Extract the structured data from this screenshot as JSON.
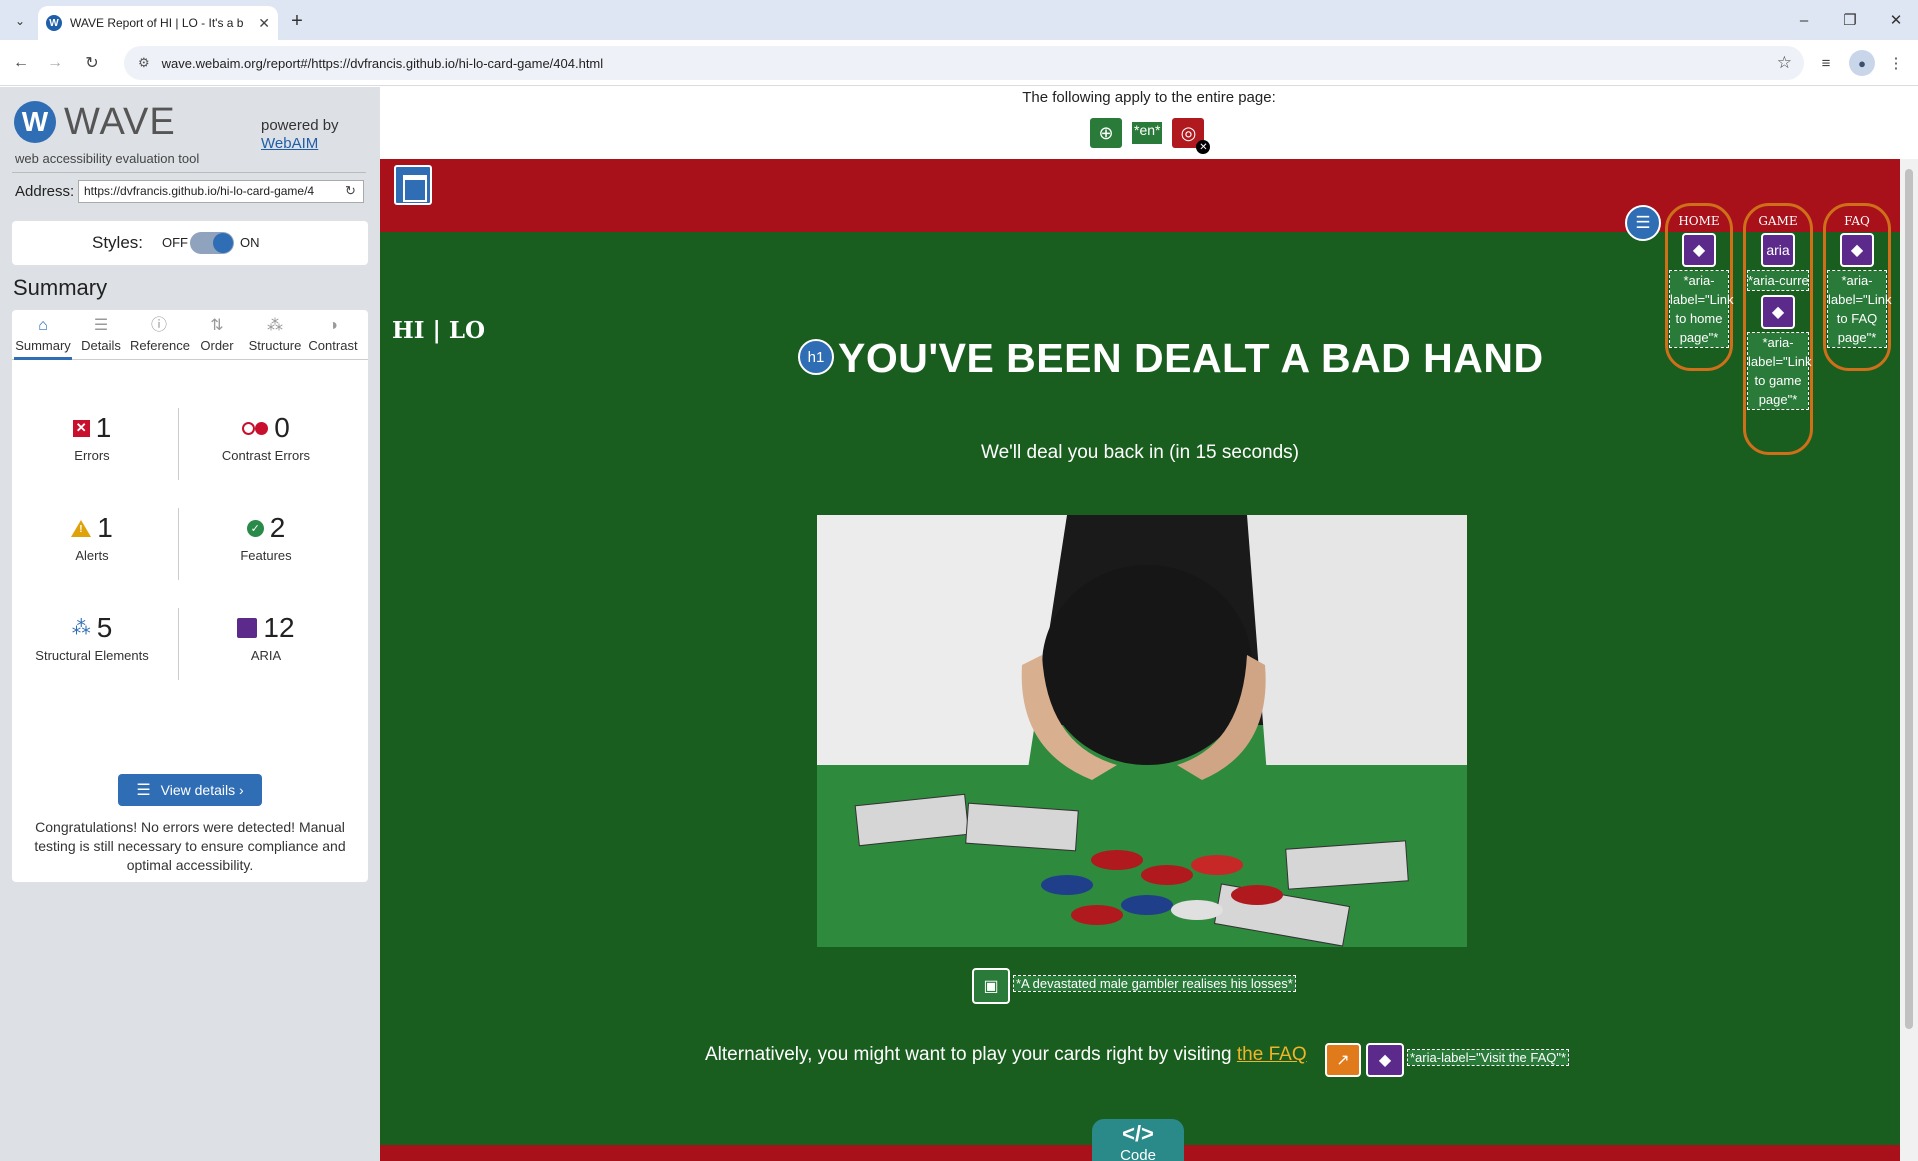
{
  "browser": {
    "tab_title": "WAVE Report of HI | LO - It's a b",
    "tab_favicon": "W",
    "url": "wave.webaim.org/report#/https://dvfrancis.github.io/hi-lo-card-game/404.html"
  },
  "wave": {
    "logo_letter": "W",
    "logo_word": "WAVE",
    "tagline": "web accessibility evaluation tool",
    "powered_by": "powered by",
    "webaim_link": "WebAIM",
    "address_label": "Address:",
    "address_value": "https://dvfrancis.github.io/hi-lo-card-game/4",
    "styles_label": "Styles:",
    "styles_off": "OFF",
    "styles_on": "ON",
    "summary_heading": "Summary",
    "tabs": [
      {
        "label": "Summary",
        "icon": "home-icon"
      },
      {
        "label": "Details",
        "icon": "list-icon"
      },
      {
        "label": "Reference",
        "icon": "info-icon"
      },
      {
        "label": "Order",
        "icon": "order-icon"
      },
      {
        "label": "Structure",
        "icon": "structure-icon"
      },
      {
        "label": "Contrast",
        "icon": "contrast-icon"
      }
    ],
    "stats": {
      "errors": {
        "count": "1",
        "label": "Errors"
      },
      "contrast_errors": {
        "count": "0",
        "label": "Contrast Errors"
      },
      "alerts": {
        "count": "1",
        "label": "Alerts"
      },
      "features": {
        "count": "2",
        "label": "Features"
      },
      "structural": {
        "count": "5",
        "label": "Structural Elements"
      },
      "aria": {
        "count": "12",
        "label": "ARIA"
      }
    },
    "view_details": "View details ›",
    "congrats": "Congratulations! No errors were detected! Manual testing is still necessary to ensure compliance and optimal accessibility."
  },
  "report": {
    "apply_text": "The following apply to the entire page:",
    "lang_tag": "*en*",
    "brand": "HI | LO",
    "nav": [
      {
        "label": "HOME",
        "aria": "*aria-label=\"Link to home page\"*"
      },
      {
        "label": "GAME",
        "aria_icon": "aria",
        "aria": "*aria-current=\"pa",
        "aria2": "*aria-label=\"Link to game page\"*"
      },
      {
        "label": "FAQ",
        "aria": "*aria-label=\"Link to FAQ page\"*"
      }
    ],
    "h1_badge": "h1",
    "heading": "YOU'VE BEEN DEALT A BAD HAND",
    "subheading": "We'll deal you back in (in 15 seconds)",
    "image_alt": "*A devastated male gambler realises his losses*",
    "faq_text": "Alternatively, you might want to play your cards right by visiting ",
    "faq_link": "the FAQ",
    "faq_aria": "*aria-label=\"Visit the FAQ\"*",
    "code_glyph": "</>",
    "code_label": "Code"
  },
  "colors": {
    "site_green": "#1a5e1f",
    "header_red": "#a8101a",
    "wave_blue": "#2f6db4",
    "aria_purple": "#5b2a8a",
    "nav_outline": "#cf6f1a"
  }
}
